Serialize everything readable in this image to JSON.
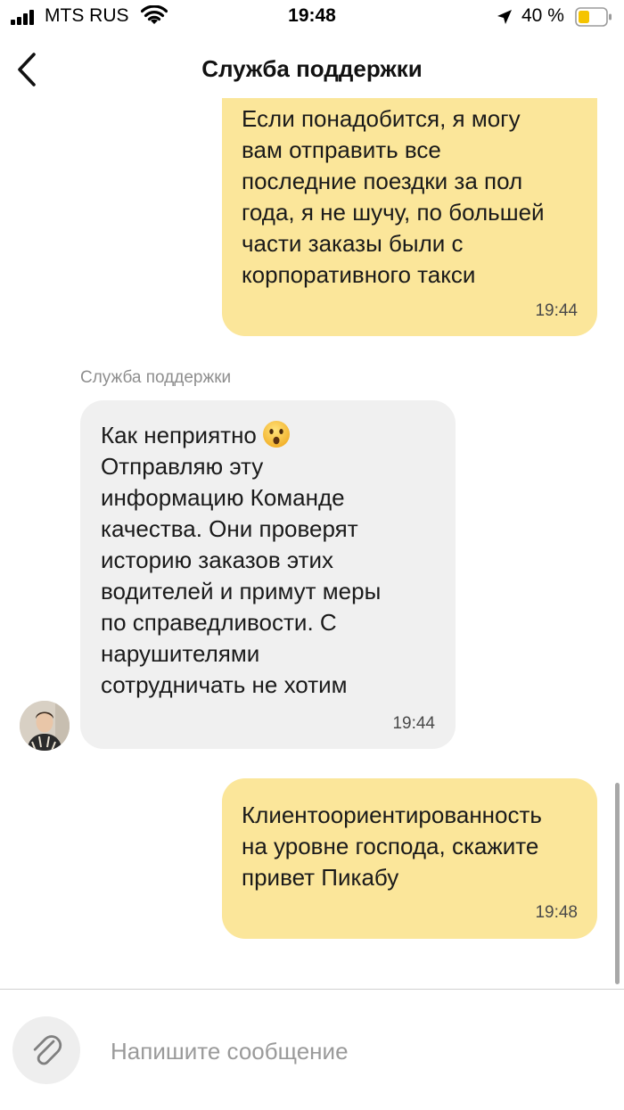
{
  "status_bar": {
    "carrier": "MTS RUS",
    "time": "19:48",
    "battery_percent": "40 %",
    "icons": [
      "signal-icon",
      "wifi-icon",
      "location-icon",
      "battery-icon"
    ]
  },
  "header": {
    "title": "Служба поддержки",
    "back_icon": "chevron-left-icon"
  },
  "messages": [
    {
      "direction": "outgoing",
      "text": "Если понадобится, я могу\nвам отправить все\nпоследние поездки за пол\nгода, я не шучу, по большей\nчасти заказы были с\nкорпоративного такси",
      "time": "19:44"
    },
    {
      "direction": "incoming",
      "sender": "Служба поддержки",
      "first_line": "Как неприятно",
      "emoji": "astonished-face-emoji",
      "text": "Отправляю эту\nинформацию Команде\nкачества. Они проверят\nисторию заказов этих\nводителей и примут меры\nпо справедливости. С\nнарушителями\nсотрудничать не хотим",
      "time": "19:44"
    },
    {
      "direction": "outgoing",
      "text": "Клиентоориентированность\nна уровне господа, скажите\nпривет Пикабу",
      "time": "19:48"
    }
  ],
  "composer": {
    "placeholder": "Напишите сообщение",
    "value": "",
    "attach_icon": "paperclip-icon"
  },
  "colors": {
    "outgoing_bubble": "#fbe69a",
    "incoming_bubble": "#f0f0f0",
    "sender_label": "#8e8e8e",
    "placeholder": "#9a9a9a"
  }
}
